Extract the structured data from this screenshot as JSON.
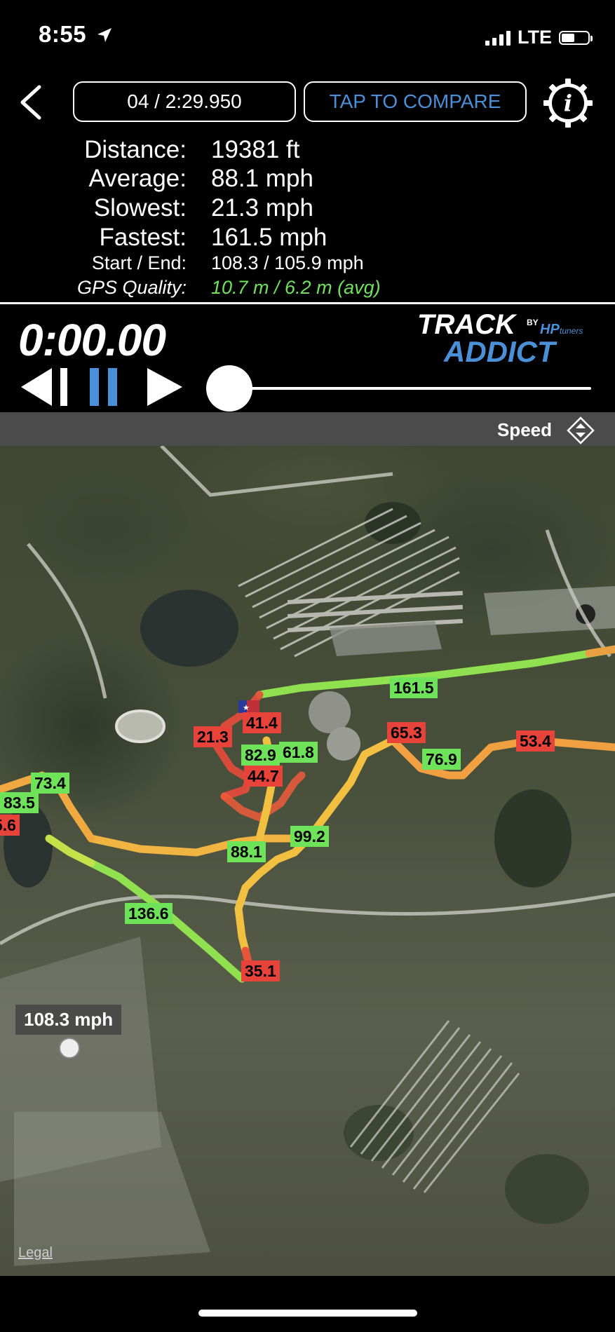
{
  "status_bar": {
    "time": "8:55",
    "network": "LTE",
    "battery_level": 0.5
  },
  "header": {
    "lap_selector": "04 / 2:29.950",
    "compare_button": "TAP TO COMPARE"
  },
  "stats": [
    {
      "label": "Distance:",
      "value": "19381 ft"
    },
    {
      "label": "Average:",
      "value": "88.1 mph"
    },
    {
      "label": "Slowest:",
      "value": "21.3 mph"
    },
    {
      "label": "Fastest:",
      "value": "161.5 mph"
    },
    {
      "label": "Start / End:",
      "value": "108.3 / 105.9 mph"
    },
    {
      "label": "GPS Quality:",
      "value": "10.7 m / 6.2 m (avg)"
    }
  ],
  "colors": {
    "accent_blue": "#4a90d9",
    "gps_good": "#6ee35a",
    "slow_red": "#e8433a",
    "fast_green": "#6ee35a"
  },
  "playback": {
    "timer": "0:00.00",
    "progress": 0
  },
  "logo": {
    "line1": "TRACK",
    "by": "BY",
    "brand": "HP",
    "brand_suffix": "tuners",
    "line2": "ADDICT"
  },
  "metric_selector": {
    "label": "Speed"
  },
  "map": {
    "speed_labels": [
      "161.5",
      "41.4",
      "21.3",
      "82.9",
      "61.8",
      "44.7",
      "65.3",
      "53.4",
      "76.9",
      "73.4",
      "83.5",
      "5.6",
      "99.2",
      "88.1",
      "136.6",
      "35.1"
    ],
    "marker_label": "108.3 mph",
    "legal": "Legal"
  }
}
